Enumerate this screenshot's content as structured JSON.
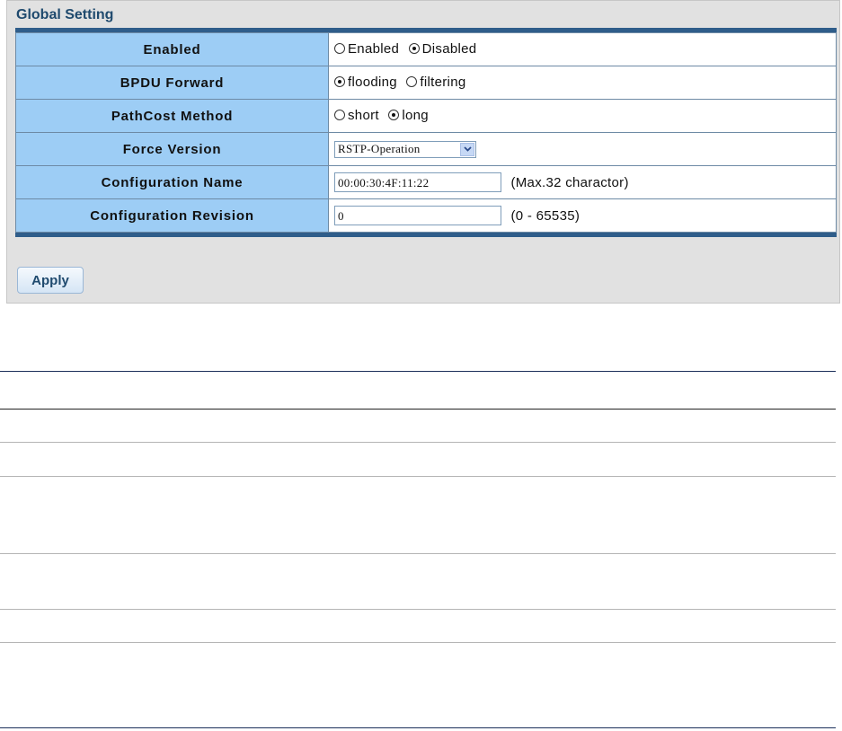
{
  "panel": {
    "title": "Global Setting",
    "rows": {
      "enabled": {
        "label": "Enabled",
        "options": [
          "Enabled",
          "Disabled"
        ],
        "selected": "Disabled"
      },
      "bpdu_forward": {
        "label": "BPDU Forward",
        "options": [
          "flooding",
          "filtering"
        ],
        "selected": "flooding"
      },
      "pathcost_method": {
        "label": "PathCost Method",
        "options": [
          "short",
          "long"
        ],
        "selected": "long"
      },
      "force_version": {
        "label": "Force Version",
        "value": "RSTP-Operation"
      },
      "configuration_name": {
        "label": "Configuration Name",
        "value": "00:00:30:4F:11:22",
        "hint": "(Max.32 charactor)"
      },
      "configuration_revision": {
        "label": "Configuration Revision",
        "value": "0",
        "hint": "(0 - 65535)"
      }
    },
    "apply_label": "Apply"
  },
  "colors": {
    "label_cell_bg": "#9dcdf5",
    "table_bar": "#2f5d8a",
    "title_text": "#1f4a6e",
    "panel_bg": "#e1e1e1"
  }
}
